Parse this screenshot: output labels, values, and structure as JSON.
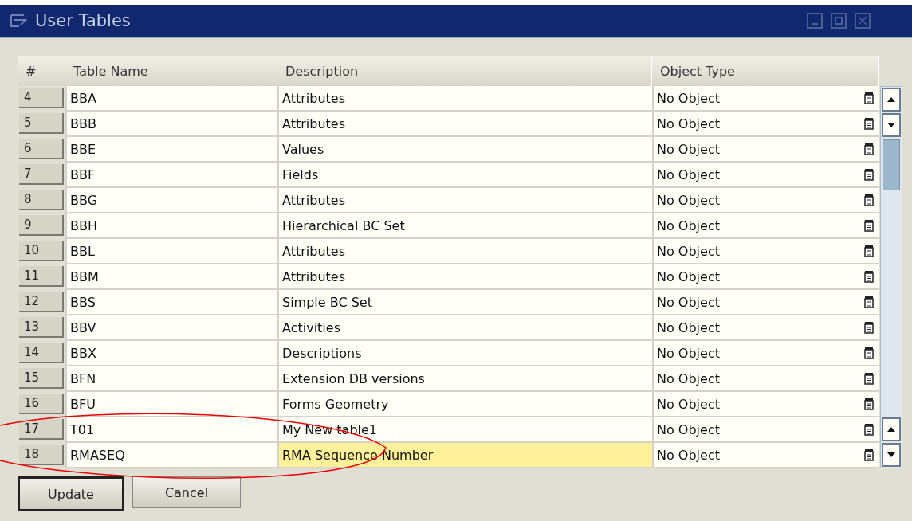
{
  "window": {
    "title": "User Tables"
  },
  "table": {
    "columns": [
      "#",
      "Table Name",
      "Description",
      "Object Type"
    ],
    "rows": [
      {
        "number": "4",
        "name": "BBA",
        "description": "Attributes",
        "object_type": "No Object",
        "focused": false
      },
      {
        "number": "5",
        "name": "BBB",
        "description": "Attributes",
        "object_type": "No Object",
        "focused": false
      },
      {
        "number": "6",
        "name": "BBE",
        "description": "Values",
        "object_type": "No Object",
        "focused": false
      },
      {
        "number": "7",
        "name": "BBF",
        "description": "Fields",
        "object_type": "No Object",
        "focused": false
      },
      {
        "number": "8",
        "name": "BBG",
        "description": "Attributes",
        "object_type": "No Object",
        "focused": false
      },
      {
        "number": "9",
        "name": "BBH",
        "description": "Hierarchical BC Set",
        "object_type": "No Object",
        "focused": false
      },
      {
        "number": "10",
        "name": "BBL",
        "description": "Attributes",
        "object_type": "No Object",
        "focused": false
      },
      {
        "number": "11",
        "name": "BBM",
        "description": "Attributes",
        "object_type": "No Object",
        "focused": false
      },
      {
        "number": "12",
        "name": "BBS",
        "description": "Simple BC Set",
        "object_type": "No Object",
        "focused": false
      },
      {
        "number": "13",
        "name": "BBV",
        "description": "Activities",
        "object_type": "No Object",
        "focused": false
      },
      {
        "number": "14",
        "name": "BBX",
        "description": "Descriptions",
        "object_type": "No Object",
        "focused": false
      },
      {
        "number": "15",
        "name": "BFN",
        "description": "Extension DB versions",
        "object_type": "No Object",
        "focused": false
      },
      {
        "number": "16",
        "name": "BFU",
        "description": "Forms Geometry",
        "object_type": "No Object",
        "focused": false
      },
      {
        "number": "17",
        "name": "T01",
        "description": "My New table1",
        "object_type": "No Object",
        "focused": false
      },
      {
        "number": "18",
        "name": "RMASEQ",
        "description": "RMA Sequence Number",
        "object_type": "No Object",
        "focused": true
      }
    ]
  },
  "buttons": [
    {
      "label": "Update",
      "default": true
    },
    {
      "label": "Cancel",
      "default": false
    }
  ]
}
